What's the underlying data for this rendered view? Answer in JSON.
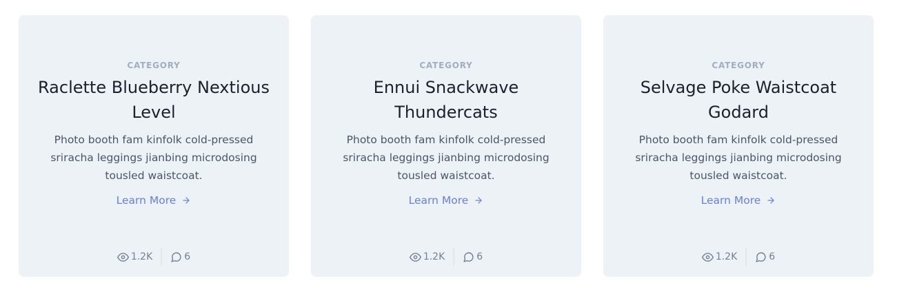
{
  "cards": [
    {
      "category": "CATEGORY",
      "title": "Raclette Blueberry Nextious Level",
      "description": "Photo booth fam kinfolk cold-pressed sriracha leggings jianbing microdosing tousled waistcoat.",
      "link_label": "Learn More",
      "views": "1.2K",
      "comments": "6"
    },
    {
      "category": "CATEGORY",
      "title": "Ennui Snackwave Thundercats",
      "description": "Photo booth fam kinfolk cold-pressed sriracha leggings jianbing microdosing tousled waistcoat.",
      "link_label": "Learn More",
      "views": "1.2K",
      "comments": "6"
    },
    {
      "category": "CATEGORY",
      "title": "Selvage Poke Waistcoat Godard",
      "description": "Photo booth fam kinfolk cold-pressed sriracha leggings jianbing microdosing tousled waistcoat.",
      "link_label": "Learn More",
      "views": "1.2K",
      "comments": "6"
    }
  ],
  "icons": {
    "views": "eye-icon",
    "comments": "chat-bubble-icon",
    "link": "arrow-right-icon"
  },
  "colors": {
    "card_bg": "#edf2f7",
    "category": "#a0aec0",
    "title": "#1a202c",
    "body_text": "#4a5568",
    "link": "#667eea",
    "stats": "#718096",
    "divider": "#e2e8f0"
  }
}
